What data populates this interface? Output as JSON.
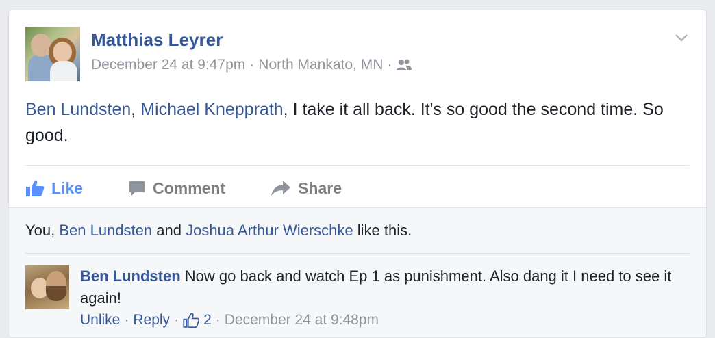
{
  "post": {
    "author": "Matthias Leyrer",
    "date": "December 24 at 9:47pm",
    "location": "North Mankato, MN",
    "dot": "·",
    "audience_icon": "friends-icon",
    "text": {
      "tag1": "Ben Lundsten",
      "comma": ", ",
      "tag2": "Michael Knepprath",
      "rest": ", I take it all back. It's so good the second time. So good."
    }
  },
  "actions": {
    "like": "Like",
    "comment": "Comment",
    "share": "Share"
  },
  "likes": {
    "you": "You, ",
    "person1": "Ben Lundsten",
    "and": " and ",
    "person2": "Joshua Arthur Wierschke",
    "suffix": " like this."
  },
  "comment": {
    "author": "Ben Lundsten",
    "text": " Now go back and watch Ep 1 as punishment. Also dang it I need to see it again!",
    "unlike": "Unlike",
    "reply": "Reply",
    "like_count": "2",
    "date": "December 24 at 9:48pm",
    "dot": "·"
  },
  "colors": {
    "link": "#365899",
    "like_active": "#5890ff",
    "meta_gray": "#90949c"
  }
}
